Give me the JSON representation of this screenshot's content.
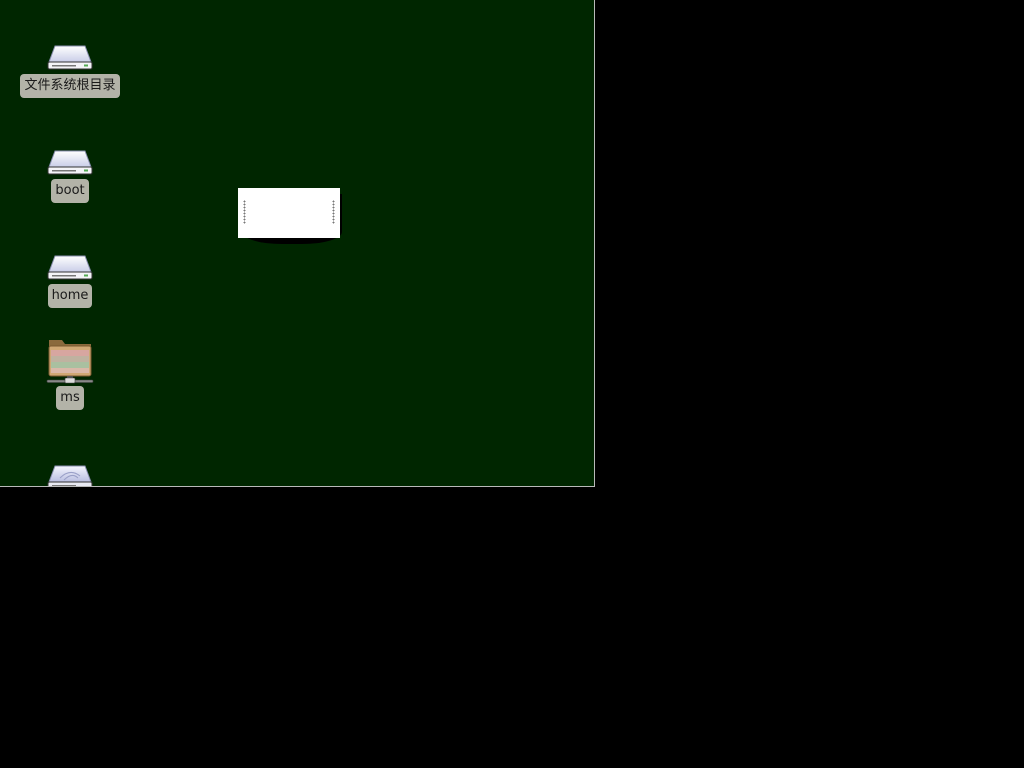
{
  "desktop": {
    "background_color": "#002600",
    "icons": [
      {
        "label": "文件系统根目录",
        "icon": "drive-icon"
      },
      {
        "label": "boot",
        "icon": "drive-icon"
      },
      {
        "label": "home",
        "icon": "drive-icon"
      },
      {
        "label": "ms",
        "icon": "network-folder-icon"
      },
      {
        "label": "",
        "icon": "removable-drive-icon"
      }
    ]
  },
  "screen": {
    "background_color": "#000000"
  }
}
